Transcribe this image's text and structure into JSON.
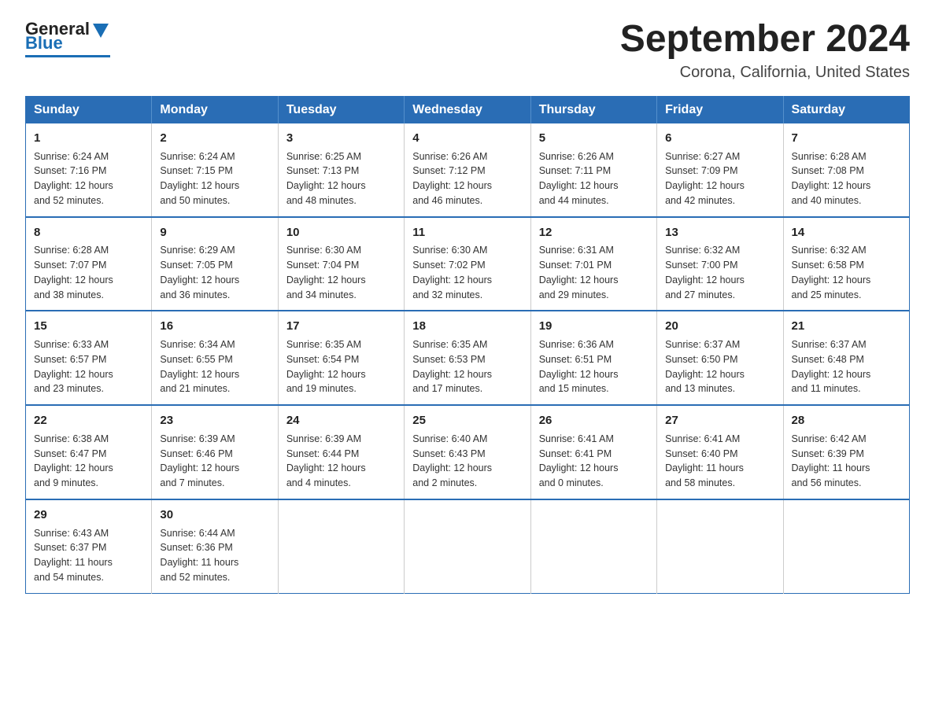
{
  "header": {
    "logo_general": "General",
    "logo_blue": "Blue",
    "month_title": "September 2024",
    "location": "Corona, California, United States"
  },
  "days_of_week": [
    "Sunday",
    "Monday",
    "Tuesday",
    "Wednesday",
    "Thursday",
    "Friday",
    "Saturday"
  ],
  "weeks": [
    [
      {
        "day": "1",
        "sunrise": "6:24 AM",
        "sunset": "7:16 PM",
        "daylight": "12 hours and 52 minutes."
      },
      {
        "day": "2",
        "sunrise": "6:24 AM",
        "sunset": "7:15 PM",
        "daylight": "12 hours and 50 minutes."
      },
      {
        "day": "3",
        "sunrise": "6:25 AM",
        "sunset": "7:13 PM",
        "daylight": "12 hours and 48 minutes."
      },
      {
        "day": "4",
        "sunrise": "6:26 AM",
        "sunset": "7:12 PM",
        "daylight": "12 hours and 46 minutes."
      },
      {
        "day": "5",
        "sunrise": "6:26 AM",
        "sunset": "7:11 PM",
        "daylight": "12 hours and 44 minutes."
      },
      {
        "day": "6",
        "sunrise": "6:27 AM",
        "sunset": "7:09 PM",
        "daylight": "12 hours and 42 minutes."
      },
      {
        "day": "7",
        "sunrise": "6:28 AM",
        "sunset": "7:08 PM",
        "daylight": "12 hours and 40 minutes."
      }
    ],
    [
      {
        "day": "8",
        "sunrise": "6:28 AM",
        "sunset": "7:07 PM",
        "daylight": "12 hours and 38 minutes."
      },
      {
        "day": "9",
        "sunrise": "6:29 AM",
        "sunset": "7:05 PM",
        "daylight": "12 hours and 36 minutes."
      },
      {
        "day": "10",
        "sunrise": "6:30 AM",
        "sunset": "7:04 PM",
        "daylight": "12 hours and 34 minutes."
      },
      {
        "day": "11",
        "sunrise": "6:30 AM",
        "sunset": "7:02 PM",
        "daylight": "12 hours and 32 minutes."
      },
      {
        "day": "12",
        "sunrise": "6:31 AM",
        "sunset": "7:01 PM",
        "daylight": "12 hours and 29 minutes."
      },
      {
        "day": "13",
        "sunrise": "6:32 AM",
        "sunset": "7:00 PM",
        "daylight": "12 hours and 27 minutes."
      },
      {
        "day": "14",
        "sunrise": "6:32 AM",
        "sunset": "6:58 PM",
        "daylight": "12 hours and 25 minutes."
      }
    ],
    [
      {
        "day": "15",
        "sunrise": "6:33 AM",
        "sunset": "6:57 PM",
        "daylight": "12 hours and 23 minutes."
      },
      {
        "day": "16",
        "sunrise": "6:34 AM",
        "sunset": "6:55 PM",
        "daylight": "12 hours and 21 minutes."
      },
      {
        "day": "17",
        "sunrise": "6:35 AM",
        "sunset": "6:54 PM",
        "daylight": "12 hours and 19 minutes."
      },
      {
        "day": "18",
        "sunrise": "6:35 AM",
        "sunset": "6:53 PM",
        "daylight": "12 hours and 17 minutes."
      },
      {
        "day": "19",
        "sunrise": "6:36 AM",
        "sunset": "6:51 PM",
        "daylight": "12 hours and 15 minutes."
      },
      {
        "day": "20",
        "sunrise": "6:37 AM",
        "sunset": "6:50 PM",
        "daylight": "12 hours and 13 minutes."
      },
      {
        "day": "21",
        "sunrise": "6:37 AM",
        "sunset": "6:48 PM",
        "daylight": "12 hours and 11 minutes."
      }
    ],
    [
      {
        "day": "22",
        "sunrise": "6:38 AM",
        "sunset": "6:47 PM",
        "daylight": "12 hours and 9 minutes."
      },
      {
        "day": "23",
        "sunrise": "6:39 AM",
        "sunset": "6:46 PM",
        "daylight": "12 hours and 7 minutes."
      },
      {
        "day": "24",
        "sunrise": "6:39 AM",
        "sunset": "6:44 PM",
        "daylight": "12 hours and 4 minutes."
      },
      {
        "day": "25",
        "sunrise": "6:40 AM",
        "sunset": "6:43 PM",
        "daylight": "12 hours and 2 minutes."
      },
      {
        "day": "26",
        "sunrise": "6:41 AM",
        "sunset": "6:41 PM",
        "daylight": "12 hours and 0 minutes."
      },
      {
        "day": "27",
        "sunrise": "6:41 AM",
        "sunset": "6:40 PM",
        "daylight": "11 hours and 58 minutes."
      },
      {
        "day": "28",
        "sunrise": "6:42 AM",
        "sunset": "6:39 PM",
        "daylight": "11 hours and 56 minutes."
      }
    ],
    [
      {
        "day": "29",
        "sunrise": "6:43 AM",
        "sunset": "6:37 PM",
        "daylight": "11 hours and 54 minutes."
      },
      {
        "day": "30",
        "sunrise": "6:44 AM",
        "sunset": "6:36 PM",
        "daylight": "11 hours and 52 minutes."
      },
      null,
      null,
      null,
      null,
      null
    ]
  ],
  "labels": {
    "sunrise": "Sunrise:",
    "sunset": "Sunset:",
    "daylight": "Daylight:"
  }
}
